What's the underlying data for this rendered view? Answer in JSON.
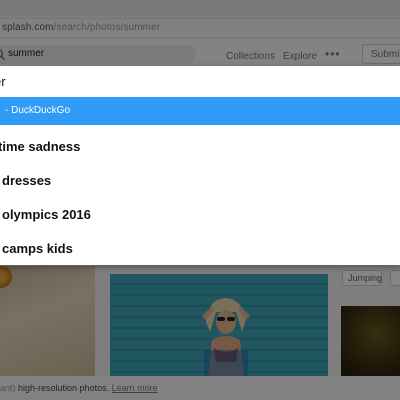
{
  "browser": {
    "url_host": "splash.com",
    "url_path": "/search/photos/summer"
  },
  "header": {
    "search_query": "summer",
    "nav": [
      "Collections",
      "Explore"
    ],
    "more": "•••",
    "submit_label": "Submit"
  },
  "tags": [
    "Jumping"
  ],
  "footer": {
    "prefix": "ant) ",
    "text": "high-resolution photos.",
    "link": "Learn more"
  },
  "dropdown": {
    "query_text": "er",
    "engine_text": "- DuckDuckGo",
    "suggestions": [
      "time sadness",
      "dresses",
      "olympics 2016",
      "camps kids"
    ]
  },
  "colors": {
    "highlight": "#2f9bf6",
    "overlay": "rgba(0,0,0,0.48)"
  }
}
